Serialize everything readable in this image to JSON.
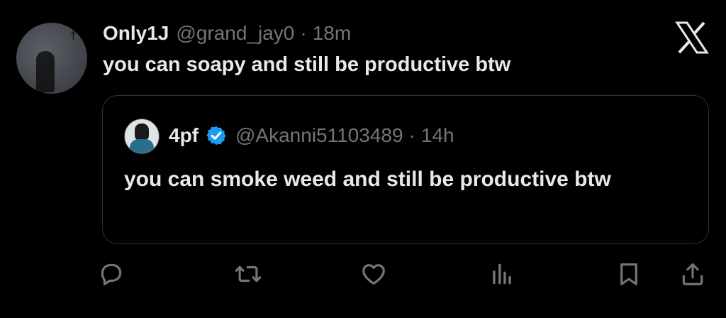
{
  "tweet": {
    "author_name": "Only1J",
    "author_handle": "@grand_jay0",
    "separator": "·",
    "time": "18m",
    "text": "you can soapy and still be productive btw"
  },
  "quoted_tweet": {
    "author_name": "4pf",
    "verified": true,
    "author_handle": "@Akanni51103489",
    "separator": "·",
    "time": "14h",
    "text": "you can smoke weed and still be productive btw"
  },
  "colors": {
    "background": "#000000",
    "text_primary": "#e7e9ea",
    "text_secondary": "#71767b",
    "border": "#2f3336",
    "verified_blue": "#1d9bf0"
  },
  "icons": {
    "close": "x-logo-icon",
    "reply": "reply-icon",
    "retweet": "retweet-icon",
    "like": "heart-icon",
    "views": "views-icon",
    "bookmark": "bookmark-icon",
    "share": "share-icon"
  }
}
